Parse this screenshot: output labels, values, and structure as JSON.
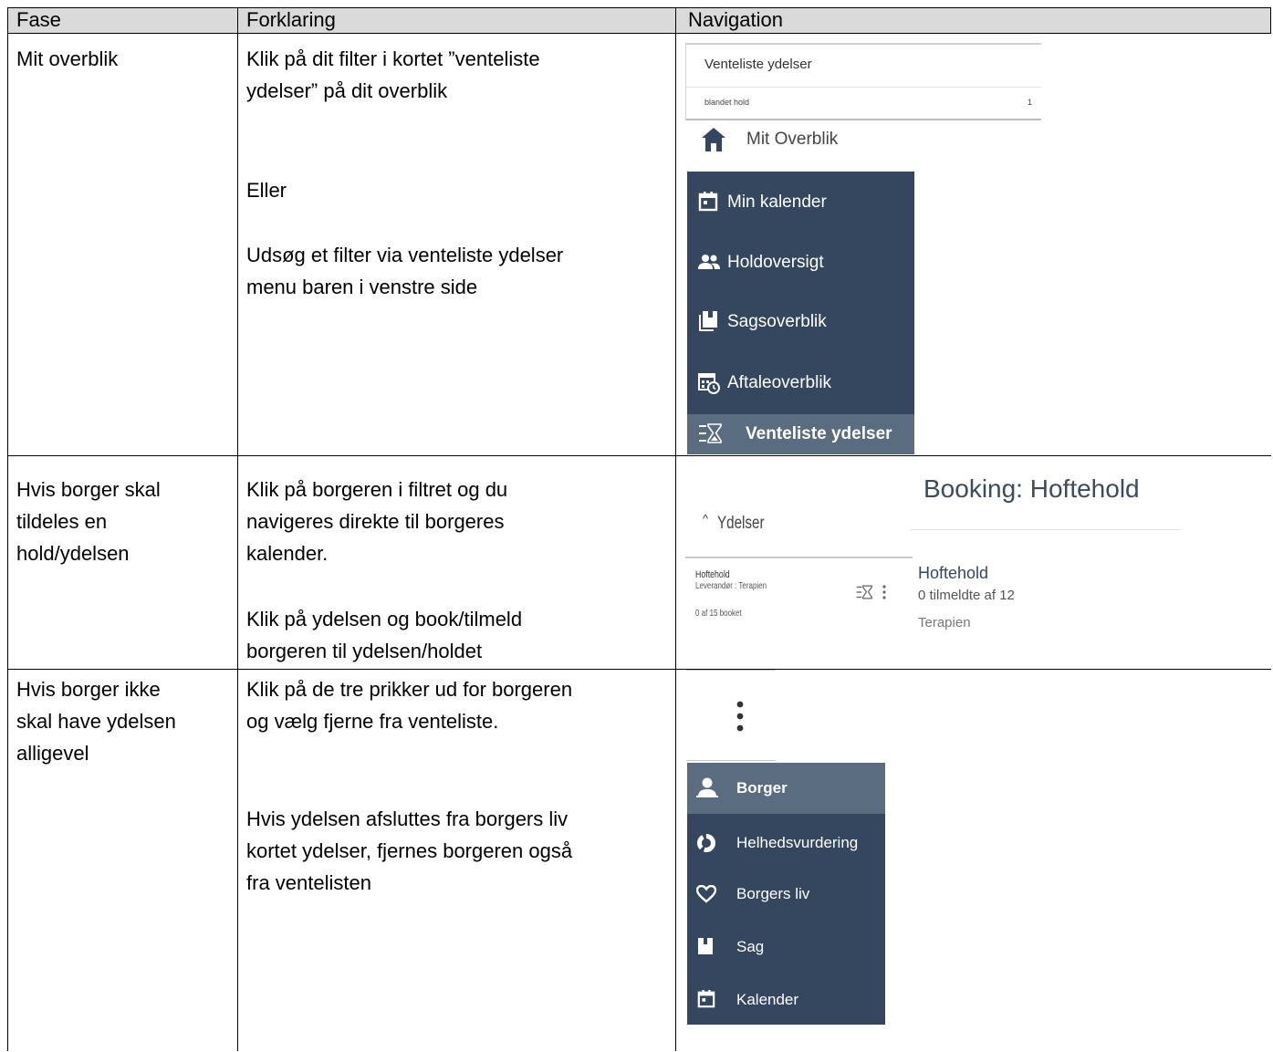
{
  "table": {
    "headers": {
      "fase": "Fase",
      "forklaring": "Forklaring",
      "navigation": "Navigation"
    },
    "rows": [
      {
        "fase": "Mit overblik",
        "forklaring": [
          "Klik på dit filter i kortet ”venteliste",
          "ydelser” på dit overblik",
          "Eller",
          "Udsøg et filter via venteliste ydelser",
          "menu baren i venstre side"
        ]
      },
      {
        "fase": [
          "Hvis borger skal",
          "tildeles en",
          "hold/ydelsen"
        ],
        "forklaring": [
          "Klik på borgeren i filtret og du",
          "navigeres direkte til borgeres",
          "kalender.",
          "Klik på ydelsen og book/tilmeld",
          "borgeren til ydelsen/holdet"
        ]
      },
      {
        "fase": [
          "Hvis borger ikke",
          "skal have ydelsen",
          "alligevel"
        ],
        "forklaring": [
          "Klik på de tre prikker ud for borgeren",
          "og vælg fjerne fra venteliste.",
          "Hvis ydelsen afsluttes fra borgers liv",
          "kortet ydelser, fjernes borgeren også",
          "fra ventelisten"
        ]
      }
    ]
  },
  "nav1": {
    "card_title": "Venteliste ydelser",
    "card_row_label": "blandet hold",
    "card_row_count": "1",
    "overview_label": "Mit Overblik",
    "menu": [
      {
        "label": "Min kalender",
        "icon": "calendar-icon"
      },
      {
        "label": "Holdoversigt",
        "icon": "people-icon"
      },
      {
        "label": "Sagsoverblik",
        "icon": "case-book-icon"
      },
      {
        "label": "Aftaleoverblik",
        "icon": "appointment-calendar-icon"
      },
      {
        "label": "Venteliste ydelser",
        "icon": "hourglass-list-icon",
        "active": true
      }
    ]
  },
  "nav2": {
    "section_label": "Ydelser",
    "item_name": "Hoftehold",
    "item_provider": "Leverandør : Terapien",
    "item_booked": "0 af 15 booket",
    "booking_title": "Booking: Hoftehold",
    "booking_name": "Hoftehold",
    "booking_count": "0 tilmeldte af 12",
    "booking_provider": "Terapien"
  },
  "nav3": {
    "menu": [
      {
        "label": "Borger",
        "icon": "person-icon",
        "active": true
      },
      {
        "label": "Helhedsvurdering",
        "icon": "donut-chart-icon"
      },
      {
        "label": "Borgers liv",
        "icon": "heart-icon"
      },
      {
        "label": "Sag",
        "icon": "case-book-icon"
      },
      {
        "label": "Kalender",
        "icon": "calendar-icon"
      }
    ]
  },
  "colors": {
    "nav_bg": "#34475f",
    "nav_active": "#5a6c80",
    "header_bg": "#dadada"
  }
}
